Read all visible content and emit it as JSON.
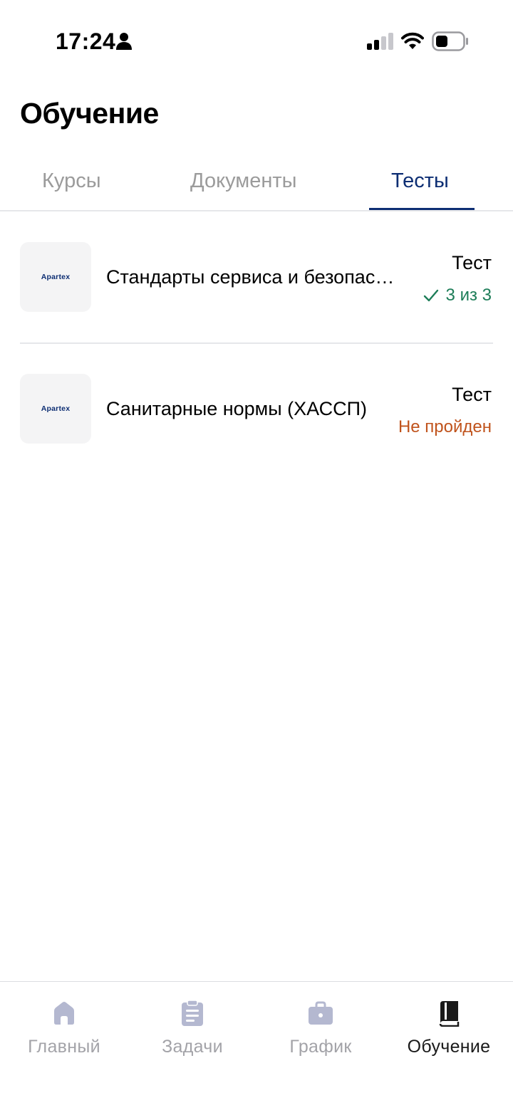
{
  "status_bar": {
    "time": "17:24",
    "icons": [
      "person-icon",
      "signal-icon",
      "wifi-icon",
      "battery-icon"
    ]
  },
  "page": {
    "title": "Обучение"
  },
  "tabs": [
    {
      "label": "Курсы",
      "active": false
    },
    {
      "label": "Документы",
      "active": false
    },
    {
      "label": "Тесты",
      "active": true
    }
  ],
  "items": [
    {
      "logo": "Apartex",
      "title": "Стандарты сервиса и безопасности",
      "type": "Тест",
      "status": "3 из 3",
      "status_kind": "passed"
    },
    {
      "logo": "Apartex",
      "title": "Санитарные нормы (ХАССП)",
      "type": "Тест",
      "status": "Не пройден",
      "status_kind": "failed"
    }
  ],
  "bottom_nav": [
    {
      "label": "Главный",
      "icon": "home-icon",
      "active": false
    },
    {
      "label": "Задачи",
      "icon": "clipboard-icon",
      "active": false
    },
    {
      "label": "График",
      "icon": "briefcase-icon",
      "active": false
    },
    {
      "label": "Обучение",
      "icon": "book-icon",
      "active": true
    }
  ],
  "colors": {
    "accent": "#0d2e73",
    "passed": "#1d7d58",
    "failed": "#c0531c",
    "inactive": "#a3a3a8"
  }
}
